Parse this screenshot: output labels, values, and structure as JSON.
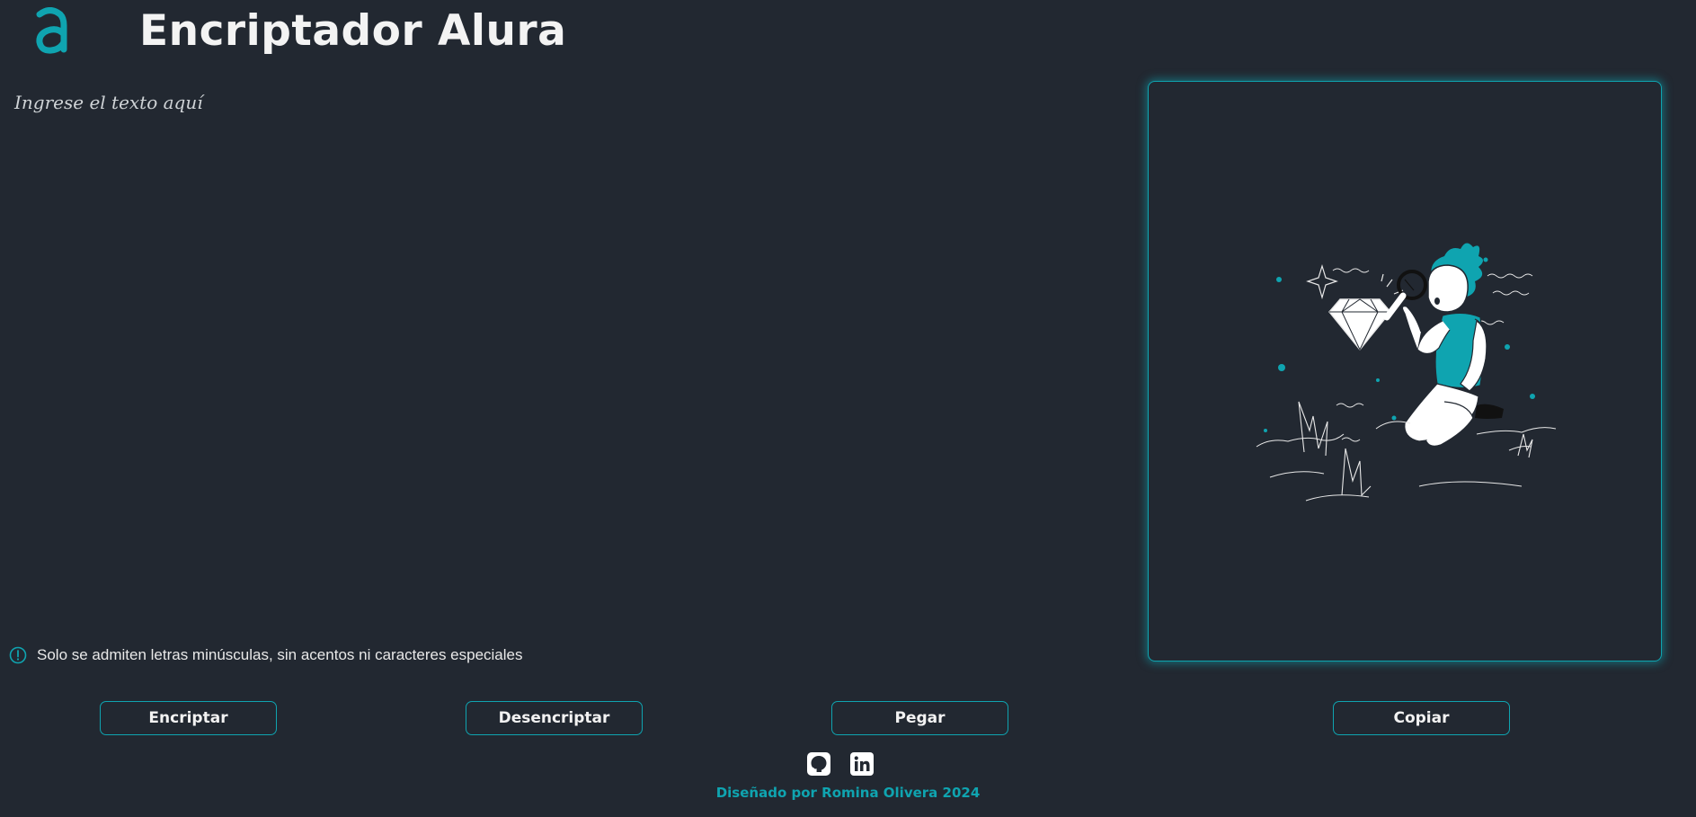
{
  "header": {
    "title": "Encriptador Alura",
    "logo_icon": "alura-logo-icon"
  },
  "input": {
    "placeholder": "Ingrese el texto aquí",
    "value": ""
  },
  "notice": {
    "icon": "exclamation-circle-icon",
    "text": "Solo se admiten letras minúsculas, sin acentos ni caracteres especiales"
  },
  "output": {
    "illustration": "person-with-magnifying-glass-diamond-illustration"
  },
  "buttons": {
    "encrypt": "Encriptar",
    "decrypt": "Desencriptar",
    "paste": "Pegar",
    "copy": "Copiar"
  },
  "footer": {
    "social_icons": [
      "github-icon",
      "linkedin-icon"
    ],
    "credit": "Diseñado por Romina Olivera 2024"
  },
  "colors": {
    "background": "#222831",
    "accent": "#0fa4b0",
    "text": "#f2f2f2"
  }
}
